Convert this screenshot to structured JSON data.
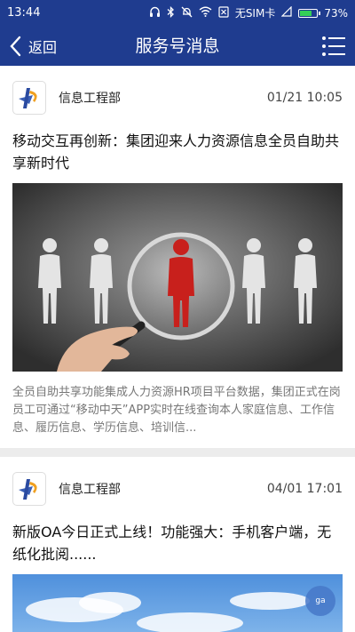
{
  "status_bar": {
    "time": "13:44",
    "sim": "无SIM卡",
    "battery": "73%",
    "battery_level": 0.73
  },
  "nav": {
    "back_label": "返回",
    "title": "服务号消息"
  },
  "messages": [
    {
      "sender": "信息工程部",
      "date": "01/21 10:05",
      "title": "移动交互再创新：集团迎来人力资源信息全员自助共享新时代",
      "summary": "全员自助共享功能集成人力资源HR项目平台数据，集团正式在岗员工可通过“移动中天”APP实时在线查询本人家庭信息、工作信息、履历信息、学历信息、培训信..."
    },
    {
      "sender": "信息工程部",
      "date": "04/01 17:01",
      "title": "新版OA今日正式上线！功能强大：手机客户端，无纸化批阅......"
    }
  ],
  "colors": {
    "header_bg": "#1f3c8f",
    "highlight_figure": "#c8201c"
  },
  "fab_label": "ga"
}
